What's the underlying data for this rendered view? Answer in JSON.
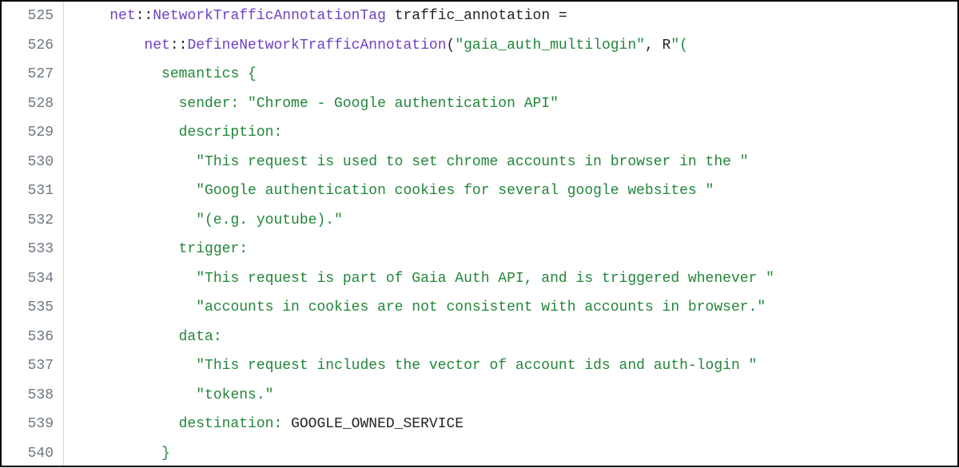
{
  "lineStart": 525,
  "lines": [
    {
      "indent": 4,
      "tokens": [
        {
          "cls": "keyword-ns",
          "t": "net"
        },
        {
          "cls": "plain",
          "t": "::"
        },
        {
          "cls": "keyword-ns",
          "t": "NetworkTrafficAnnotationTag"
        },
        {
          "cls": "plain",
          "t": " traffic_annotation ="
        }
      ]
    },
    {
      "indent": 8,
      "tokens": [
        {
          "cls": "keyword-ns",
          "t": "net"
        },
        {
          "cls": "plain",
          "t": "::"
        },
        {
          "cls": "keyword-ns",
          "t": "DefineNetworkTrafficAnnotation"
        },
        {
          "cls": "plain",
          "t": "("
        },
        {
          "cls": "string",
          "t": "\"gaia_auth_multilogin\""
        },
        {
          "cls": "plain",
          "t": ", R"
        },
        {
          "cls": "string",
          "t": "\"("
        }
      ]
    },
    {
      "indent": 10,
      "tokens": [
        {
          "cls": "raw-body",
          "t": "semantics {"
        }
      ]
    },
    {
      "indent": 12,
      "tokens": [
        {
          "cls": "raw-body",
          "t": "sender: \"Chrome - Google authentication API\""
        }
      ]
    },
    {
      "indent": 12,
      "tokens": [
        {
          "cls": "raw-body",
          "t": "description:"
        }
      ]
    },
    {
      "indent": 14,
      "tokens": [
        {
          "cls": "raw-body",
          "t": "\"This request is used to set chrome accounts in browser in the \""
        }
      ]
    },
    {
      "indent": 14,
      "tokens": [
        {
          "cls": "raw-body",
          "t": "\"Google authentication cookies for several google websites \""
        }
      ]
    },
    {
      "indent": 14,
      "tokens": [
        {
          "cls": "raw-body",
          "t": "\"(e.g. youtube).\""
        }
      ]
    },
    {
      "indent": 12,
      "tokens": [
        {
          "cls": "raw-body",
          "t": "trigger:"
        }
      ]
    },
    {
      "indent": 14,
      "tokens": [
        {
          "cls": "raw-body",
          "t": "\"This request is part of Gaia Auth API, and is triggered whenever \""
        }
      ]
    },
    {
      "indent": 14,
      "tokens": [
        {
          "cls": "raw-body",
          "t": "\"accounts in cookies are not consistent with accounts in browser.\""
        }
      ]
    },
    {
      "indent": 12,
      "tokens": [
        {
          "cls": "raw-body",
          "t": "data:"
        }
      ]
    },
    {
      "indent": 14,
      "tokens": [
        {
          "cls": "raw-body",
          "t": "\"This request includes the vector of account ids and auth-login \""
        }
      ]
    },
    {
      "indent": 14,
      "tokens": [
        {
          "cls": "raw-body",
          "t": "\"tokens.\""
        }
      ]
    },
    {
      "indent": 12,
      "tokens": [
        {
          "cls": "raw-body",
          "t": "destination: "
        },
        {
          "cls": "raw-black",
          "t": "GOOGLE_OWNED_SERVICE"
        }
      ]
    },
    {
      "indent": 10,
      "tokens": [
        {
          "cls": "raw-body",
          "t": "}"
        }
      ]
    }
  ]
}
